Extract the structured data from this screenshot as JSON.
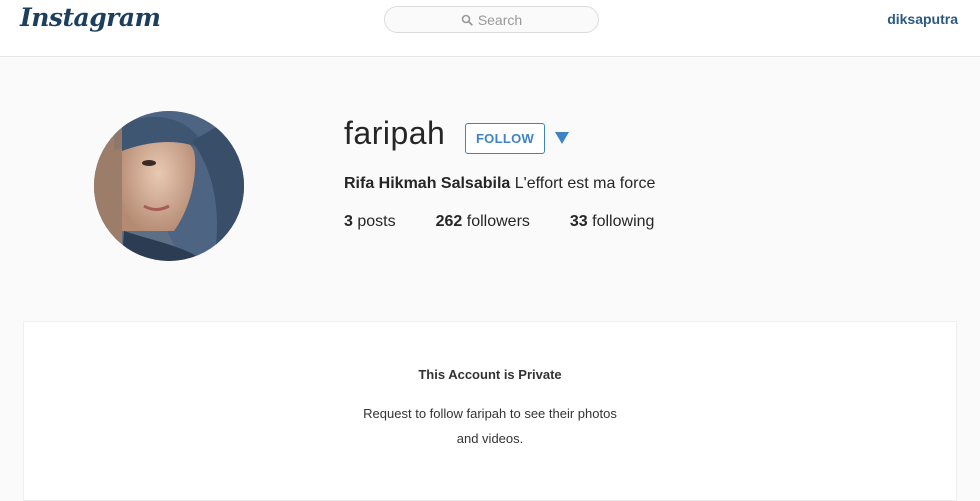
{
  "header": {
    "logo_text": "Instagram",
    "search_placeholder": "Search",
    "current_user": "diksaputra"
  },
  "profile": {
    "username": "faripah",
    "follow_label": "FOLLOW",
    "full_name": "Rifa Hikmah Salsabila",
    "bio": "L'effort est ma force",
    "stats": {
      "posts_count": "3",
      "posts_label": "posts",
      "followers_count": "262",
      "followers_label": "followers",
      "following_count": "33",
      "following_label": "following"
    }
  },
  "private_notice": {
    "title": "This Account is Private",
    "message": "Request to follow faripah to see their photos and videos."
  },
  "colors": {
    "accent": "#3f83c6",
    "logo": "#1c3f5f",
    "username_link": "#2a5a80"
  },
  "icons": [
    "search-icon",
    "dropdown-arrow-icon",
    "avatar"
  ]
}
